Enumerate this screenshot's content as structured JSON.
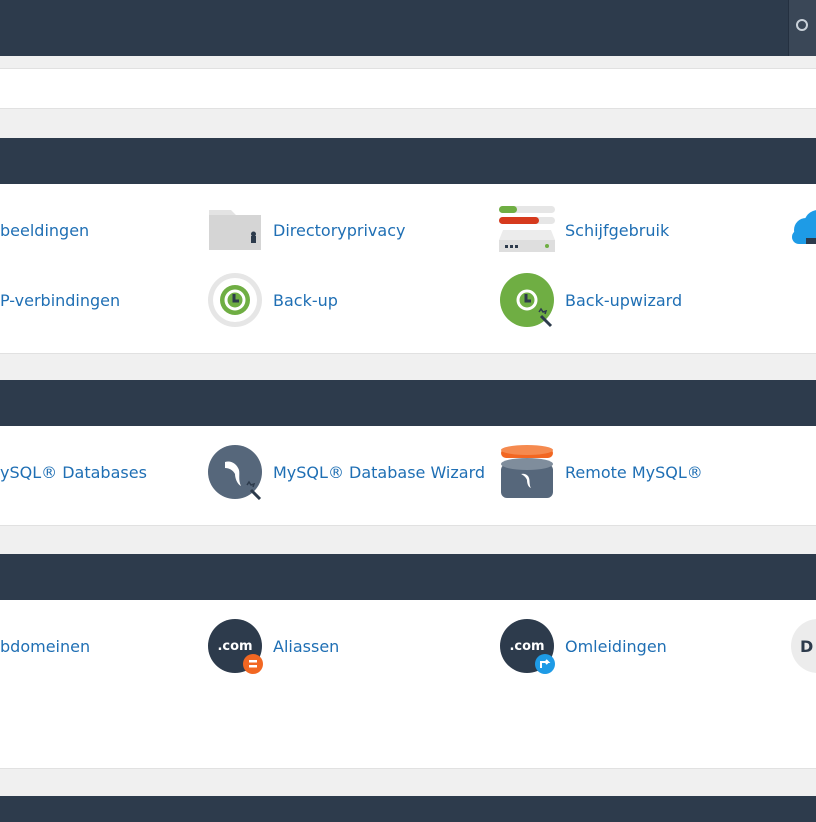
{
  "sections": {
    "files": {
      "items": [
        {
          "label": "beeldingen"
        },
        {
          "label": "Directoryprivacy"
        },
        {
          "label": "Schijfgebruik"
        },
        {
          "label": "P-verbindingen"
        },
        {
          "label": "Back-up"
        },
        {
          "label": "Back-upwizard"
        }
      ]
    },
    "databases": {
      "items": [
        {
          "label": "ySQL® Databases"
        },
        {
          "label": "MySQL® Database Wizard"
        },
        {
          "label": "Remote MySQL®"
        }
      ]
    },
    "domains": {
      "items": [
        {
          "label": "bdomeinen"
        },
        {
          "label": "Aliassen"
        },
        {
          "label": "Omleidingen"
        }
      ],
      "icon_texts": {
        "com": ".com",
        "dns": "D"
      }
    }
  },
  "colors": {
    "header": "#2d3b4c",
    "link": "#1f6fb4",
    "green": "#6fae43",
    "orange": "#f26722",
    "blue": "#1e9be6",
    "slate": "#56677b"
  }
}
